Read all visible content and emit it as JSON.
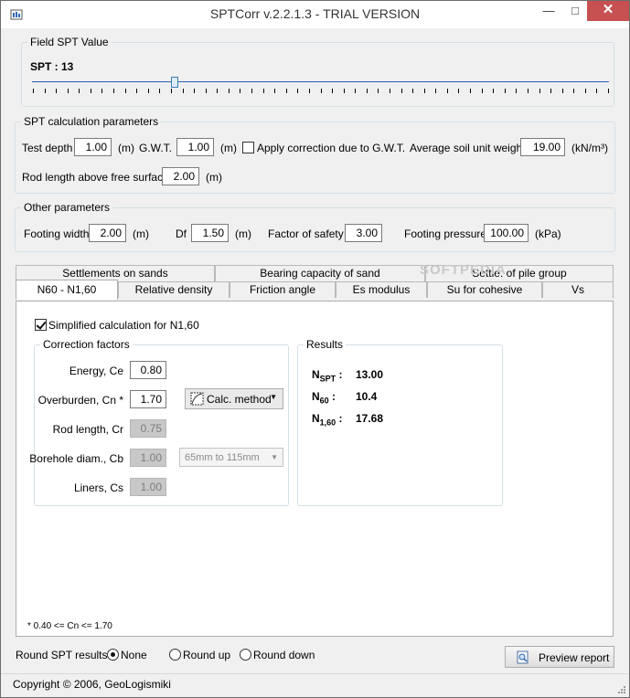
{
  "window": {
    "title": "SPTCorr v.2.2.1.3 - TRIAL VERSION",
    "minimize": "—",
    "maximize": "□",
    "close": "✕"
  },
  "field_spt": {
    "legend": "Field SPT Value",
    "label": "SPT : 13",
    "value": 13
  },
  "spt_params": {
    "legend": "SPT calculation parameters",
    "test_depth_label": "Test depth",
    "test_depth_value": "1.00",
    "test_depth_unit": "(m)",
    "gwt_label": "G.W.T.",
    "gwt_value": "1.00",
    "gwt_unit": "(m)",
    "apply_correction_label": "Apply correction due to G.W.T.",
    "apply_correction_checked": false,
    "soil_weight_label": "Average soil unit weight",
    "soil_weight_value": "19.00",
    "soil_weight_unit": "(kN/m³)",
    "rod_length_label": "Rod length above free surface",
    "rod_length_value": "2.00",
    "rod_length_unit": "(m)"
  },
  "other_params": {
    "legend": "Other parameters",
    "footing_width_label": "Footing width",
    "footing_width_value": "2.00",
    "footing_width_unit": "(m)",
    "df_label": "Df",
    "df_value": "1.50",
    "df_unit": "(m)",
    "fos_label": "Factor of safety",
    "fos_value": "3.00",
    "footing_pressure_label": "Footing pressure",
    "footing_pressure_value": "100.00",
    "footing_pressure_unit": "(kPa)"
  },
  "tabs_row1": [
    "Settlements on sands",
    "Bearing capacity of sand",
    "Settle. of pile group"
  ],
  "tabs_row2": [
    "N60 - N1,60",
    "Relative density",
    "Friction angle",
    "Es modulus",
    "Su for cohesive",
    "Vs"
  ],
  "watermark": "SOFTPEDIA",
  "n60_tab": {
    "simplified_label": "Simplified calculation for N1,60",
    "simplified_checked": true,
    "correction_legend": "Correction factors",
    "energy_label": "Energy, Ce",
    "energy_value": "0.80",
    "overburden_label": "Overburden, Cn *",
    "overburden_value": "1.70",
    "calc_method_label": "Calc. method",
    "rod_label": "Rod length, Cr",
    "rod_value": "0.75",
    "borehole_label": "Borehole diam., Cb",
    "borehole_value": "1.00",
    "borehole_option": "65mm to 115mm",
    "liners_label": "Liners, Cs",
    "liners_value": "1.00",
    "results_legend": "Results",
    "nspt_label": "N",
    "nspt_sub": "SPT",
    "nspt_value": "13.00",
    "n60_label": "N",
    "n60_sub": "60",
    "n60_value": "10.4",
    "n160_label": "N",
    "n160_sub": "1,60",
    "n160_value": "17.68",
    "footnote": "* 0.40 <= Cn <= 1.70"
  },
  "round": {
    "label": "Round SPT results :",
    "options": [
      "None",
      "Round up",
      "Round down"
    ],
    "selected": "None"
  },
  "preview_button": "Preview report",
  "copyright": "Copyright © 2006, GeoLogismiki"
}
